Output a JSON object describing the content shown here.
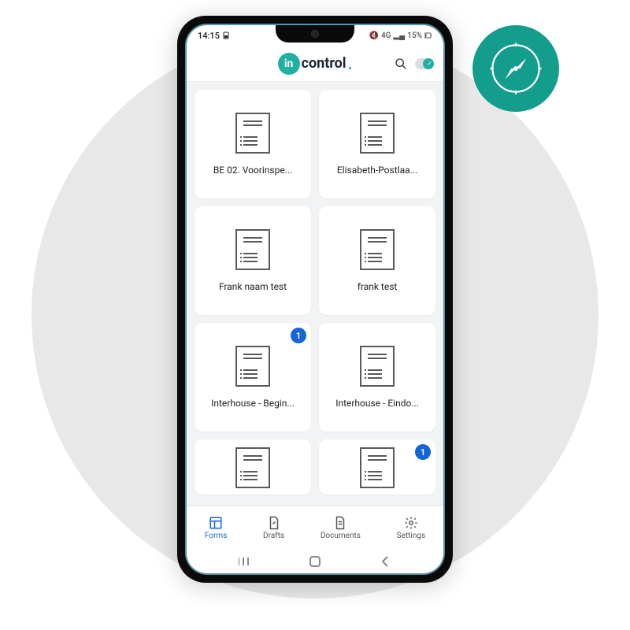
{
  "status": {
    "time": "14:15",
    "network": "4G",
    "battery": "15%"
  },
  "brand": {
    "badge": "in",
    "text": "control",
    "dot": "."
  },
  "forms": [
    {
      "label": "BE 02. Voorinspe...",
      "badge": null
    },
    {
      "label": "Elisabeth-Postlaa...",
      "badge": null
    },
    {
      "label": "Frank naam test",
      "badge": null
    },
    {
      "label": "frank test",
      "badge": null
    },
    {
      "label": "Interhouse - Begin...",
      "badge": "1"
    },
    {
      "label": "Interhouse - Eindo...",
      "badge": null
    },
    {
      "label": "",
      "badge": null
    },
    {
      "label": "",
      "badge": "1"
    }
  ],
  "nav": {
    "forms": "Forms",
    "drafts": "Drafts",
    "documents": "Documents",
    "settings": "Settings"
  }
}
